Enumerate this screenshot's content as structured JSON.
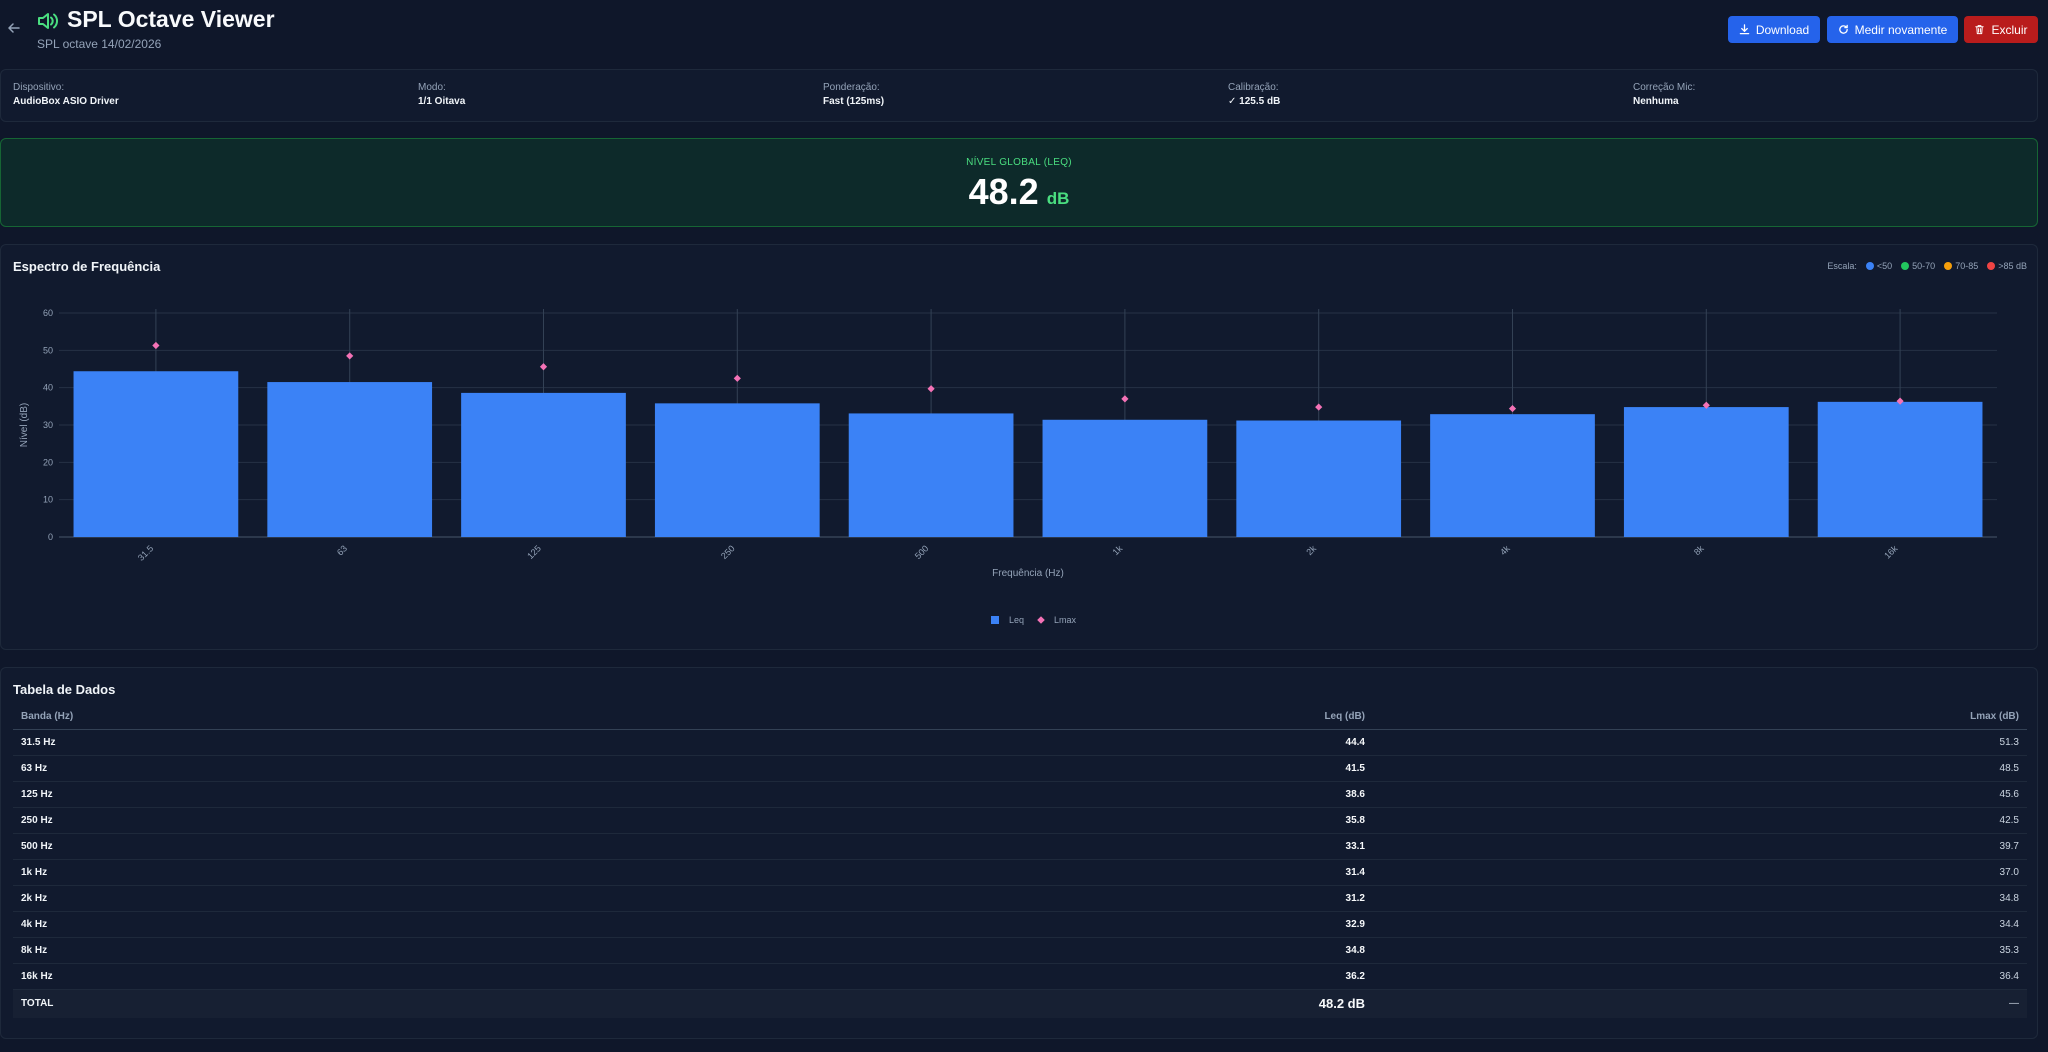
{
  "header": {
    "title": "SPL Octave Viewer",
    "subtitle": "SPL octave 14/02/2026",
    "buttons": {
      "download": "Download",
      "measure_again": "Medir novamente",
      "delete": "Excluir"
    }
  },
  "info": [
    {
      "label": "Dispositivo:",
      "value": "AudioBox ASIO Driver"
    },
    {
      "label": "Modo:",
      "value": "1/1 Oitava"
    },
    {
      "label": "Ponderação:",
      "value": "Fast (125ms)"
    },
    {
      "label": "Calibração:",
      "value": "✓ 125.5 dB"
    },
    {
      "label": "Correção Mic:",
      "value": "Nenhuma"
    }
  ],
  "global": {
    "label": "NÍVEL GLOBAL (LEQ)",
    "value": "48.2",
    "unit": "dB"
  },
  "chart": {
    "title": "Espectro de Frequência",
    "scale_label": "Escala:",
    "scale": [
      {
        "label": "<50",
        "color": "#3b82f6"
      },
      {
        "label": "50-70",
        "color": "#22c55e"
      },
      {
        "label": "70-85",
        "color": "#f59e0b"
      },
      {
        "label": ">85 dB",
        "color": "#ef4444"
      }
    ]
  },
  "chart_data": {
    "type": "bar",
    "categories": [
      "31.5",
      "63",
      "125",
      "250",
      "500",
      "1k",
      "2k",
      "4k",
      "8k",
      "16k"
    ],
    "series": [
      {
        "name": "Leq",
        "values": [
          44.4,
          41.5,
          38.6,
          35.8,
          33.1,
          31.4,
          31.2,
          32.9,
          34.8,
          36.2
        ],
        "color": "#3b82f6"
      },
      {
        "name": "Lmax",
        "values": [
          51.3,
          48.5,
          45.6,
          42.5,
          39.7,
          37.0,
          34.8,
          34.4,
          35.3,
          36.4
        ],
        "color": "#f472b6",
        "marker": "diamond"
      }
    ],
    "xlabel": "Frequência (Hz)",
    "ylabel": "Nível (dB)",
    "ylim": [
      0,
      60
    ],
    "yticks": [
      0,
      10,
      20,
      30,
      40,
      50,
      60
    ],
    "grid": true,
    "legend": "bottom-center"
  },
  "table": {
    "title": "Tabela de Dados",
    "headers": [
      "Banda (Hz)",
      "Leq (dB)",
      "Lmax (dB)"
    ],
    "rows": [
      [
        "31.5 Hz",
        "44.4",
        "51.3"
      ],
      [
        "63 Hz",
        "41.5",
        "48.5"
      ],
      [
        "125 Hz",
        "38.6",
        "45.6"
      ],
      [
        "250 Hz",
        "35.8",
        "42.5"
      ],
      [
        "500 Hz",
        "33.1",
        "39.7"
      ],
      [
        "1k Hz",
        "31.4",
        "37.0"
      ],
      [
        "2k Hz",
        "31.2",
        "34.8"
      ],
      [
        "4k Hz",
        "32.9",
        "34.4"
      ],
      [
        "8k Hz",
        "34.8",
        "35.3"
      ],
      [
        "16k Hz",
        "36.2",
        "36.4"
      ]
    ],
    "total": [
      "TOTAL",
      "48.2 dB",
      "—"
    ]
  }
}
